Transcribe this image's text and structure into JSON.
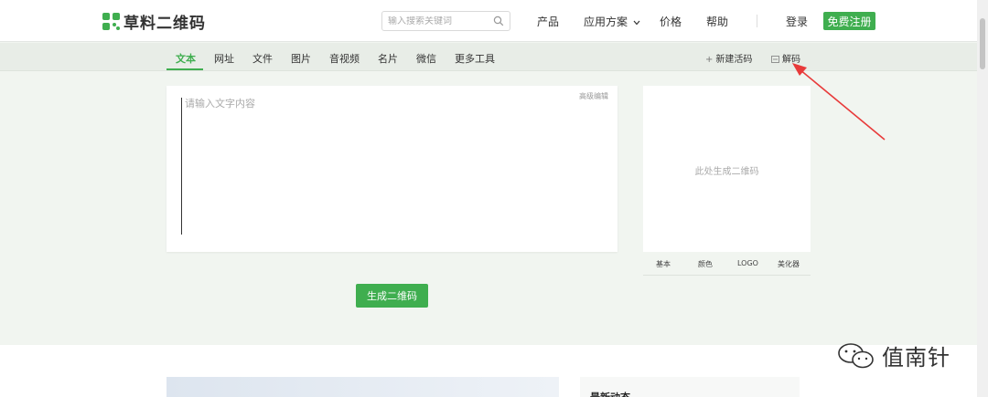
{
  "header": {
    "logo_text": "草料二维码",
    "search_placeholder": "输入搜索关键词",
    "nav": [
      "产品",
      "应用方案",
      "价格",
      "帮助"
    ],
    "login": "登录",
    "register": "免费注册"
  },
  "subnav": {
    "tabs": [
      "文本",
      "网址",
      "文件",
      "图片",
      "音视频",
      "名片",
      "微信",
      "更多工具"
    ],
    "active_tab": "文本",
    "new_live_code": "新建活码",
    "decode": "解码"
  },
  "editor": {
    "placeholder": "请输入文字内容",
    "advanced_edit": "高级编辑"
  },
  "preview": {
    "placeholder": "此处生成二维码",
    "tabs": [
      "基本",
      "颜色",
      "LOGO",
      "美化器"
    ]
  },
  "generate_button": "生成二维码",
  "lower": {
    "news_title": "最新动态"
  },
  "watermark": {
    "text": "值南针"
  },
  "colors": {
    "brand_green": "#3fae4f",
    "annotation_arrow": "#e83a3a"
  },
  "icons": [
    "logo-mark-icon",
    "search-icon",
    "chevron-down-icon",
    "plus-icon",
    "decode-icon",
    "wechat-icon"
  ]
}
